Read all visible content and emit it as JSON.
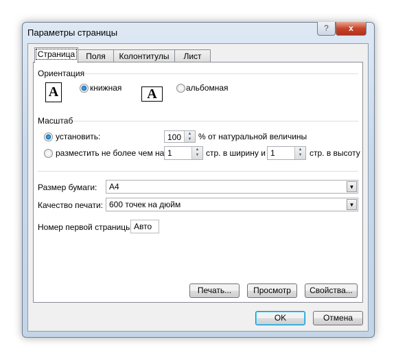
{
  "window": {
    "title": "Параметры страницы",
    "help_label": "?",
    "close_label": "x"
  },
  "tabs": [
    "Страница",
    "Поля",
    "Колонтитулы",
    "Лист"
  ],
  "orientation": {
    "label": "Ориентация",
    "icon_glyph": "A",
    "portrait": "книжная",
    "landscape": "альбомная",
    "selected": "portrait"
  },
  "scale": {
    "label": "Масштаб",
    "set_label": "установить:",
    "set_value": "100",
    "set_suffix": "% от натуральной величины",
    "fit_label": "разместить не более чем на:",
    "fit_wide": "1",
    "fit_wide_suffix": "стр. в ширину и",
    "fit_tall": "1",
    "fit_tall_suffix": "стр. в высоту",
    "selected": "set"
  },
  "paper_size": {
    "label": "Размер бумаги:",
    "value": "A4"
  },
  "print_quality": {
    "label": "Качество печати:",
    "value": "600 точек на дюйм"
  },
  "first_page": {
    "label": "Номер первой страницы:",
    "value": "Авто"
  },
  "buttons": {
    "print": "Печать...",
    "preview": "Просмотр",
    "properties": "Свойства...",
    "ok": "OK",
    "cancel": "Отмена"
  }
}
